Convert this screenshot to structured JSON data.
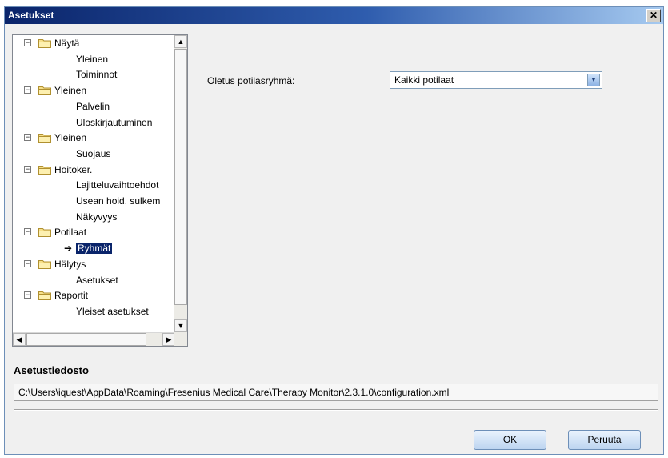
{
  "window": {
    "title": "Asetukset",
    "close_glyph": "✕"
  },
  "tree": {
    "groups": [
      {
        "label": "Näytä",
        "children": [
          "Yleinen",
          "Toiminnot"
        ]
      },
      {
        "label": "Yleinen",
        "children": [
          "Palvelin",
          "Uloskirjautuminen"
        ]
      },
      {
        "label": "Yleinen",
        "children": [
          "Suojaus"
        ]
      },
      {
        "label": "Hoitoker.",
        "children": [
          "Lajitteluvaihtoehdot",
          "Usean hoid. sulkem",
          "Näkyvyys"
        ]
      },
      {
        "label": "Potilaat",
        "children": [
          "Ryhmät"
        ]
      },
      {
        "label": "Hälytys",
        "children": [
          "Asetukset"
        ]
      },
      {
        "label": "Raportit",
        "children": [
          "Yleiset asetukset"
        ]
      }
    ],
    "selected": "Ryhmät",
    "expander_glyph": "−"
  },
  "settings": {
    "default_group_label": "Oletus potilasryhmä:",
    "default_group_value": "Kaikki potilaat"
  },
  "config": {
    "title": "Asetustiedosto",
    "path": "C:\\Users\\iquest\\AppData\\Roaming\\Fresenius Medical Care\\Therapy Monitor\\2.3.1.0\\configuration.xml"
  },
  "buttons": {
    "ok": "OK",
    "cancel": "Peruuta"
  },
  "colors": {
    "titlebar": "#0a246a",
    "selection": "#0a246a"
  }
}
